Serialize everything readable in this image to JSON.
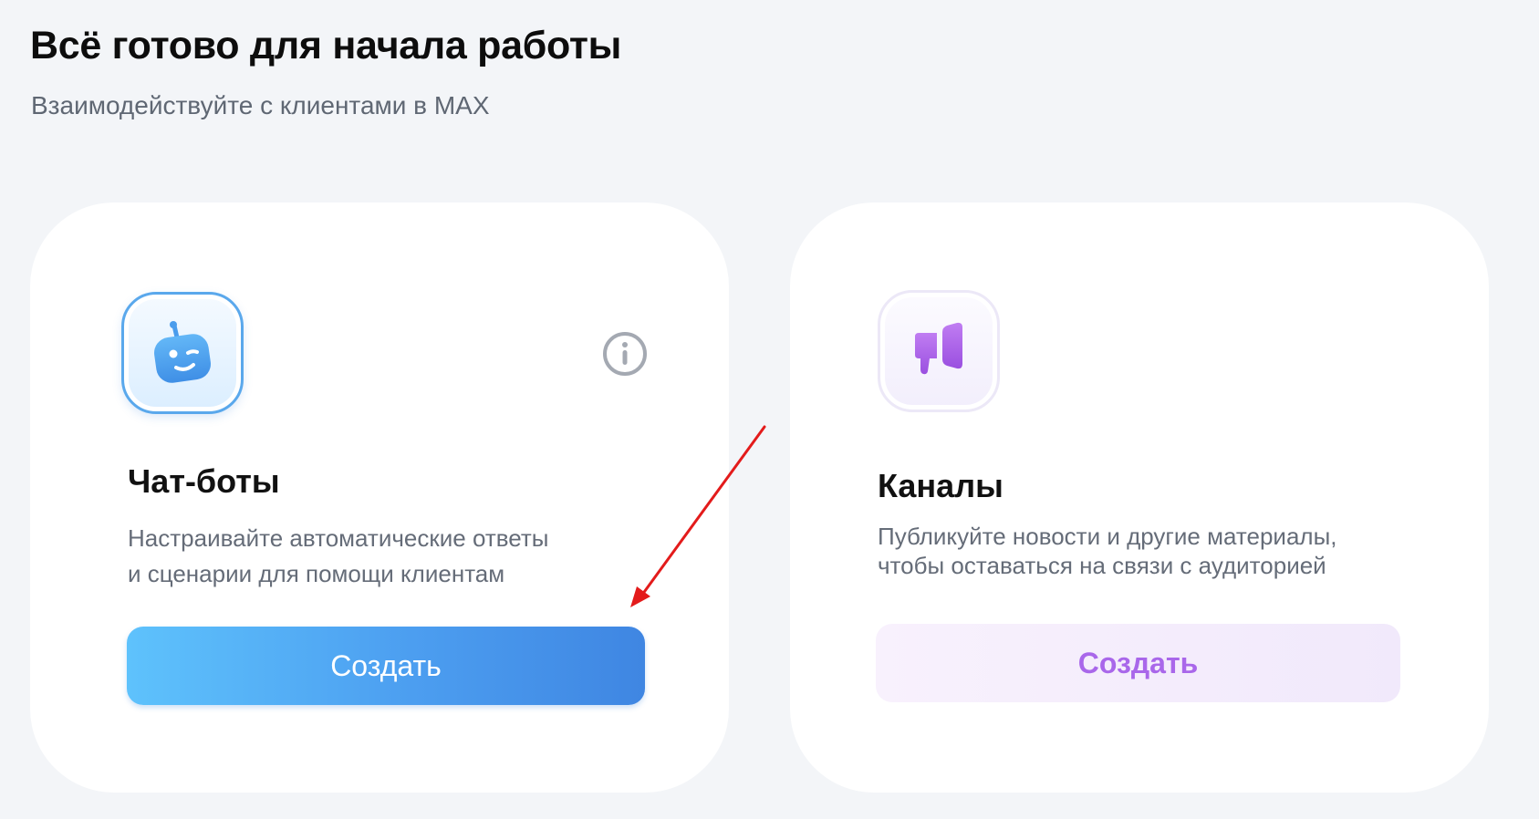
{
  "header": {
    "title": "Всё готово для начала работы",
    "subtitle": "Взаимодействуйте с клиентами в MAX"
  },
  "cards": [
    {
      "id": "chatbots",
      "icon": "robot-icon",
      "title": "Чат-боты",
      "description_lines": [
        "Настраивайте автоматические ответы",
        "и сценарии для помощи клиентам"
      ],
      "button_label": "Создать",
      "has_info": true,
      "accent_color": "#4c9ef0"
    },
    {
      "id": "channels",
      "icon": "megaphone-icon",
      "title": "Каналы",
      "description_lines": [
        "Публикуйте новости и другие материалы,",
        "чтобы оставаться на связи с аудиторией"
      ],
      "button_label": "Создать",
      "has_info": false,
      "accent_color": "#a967ea"
    }
  ],
  "colors": {
    "background": "#f3f5f8",
    "card": "#ffffff",
    "annotation_arrow": "#e31b1b"
  }
}
